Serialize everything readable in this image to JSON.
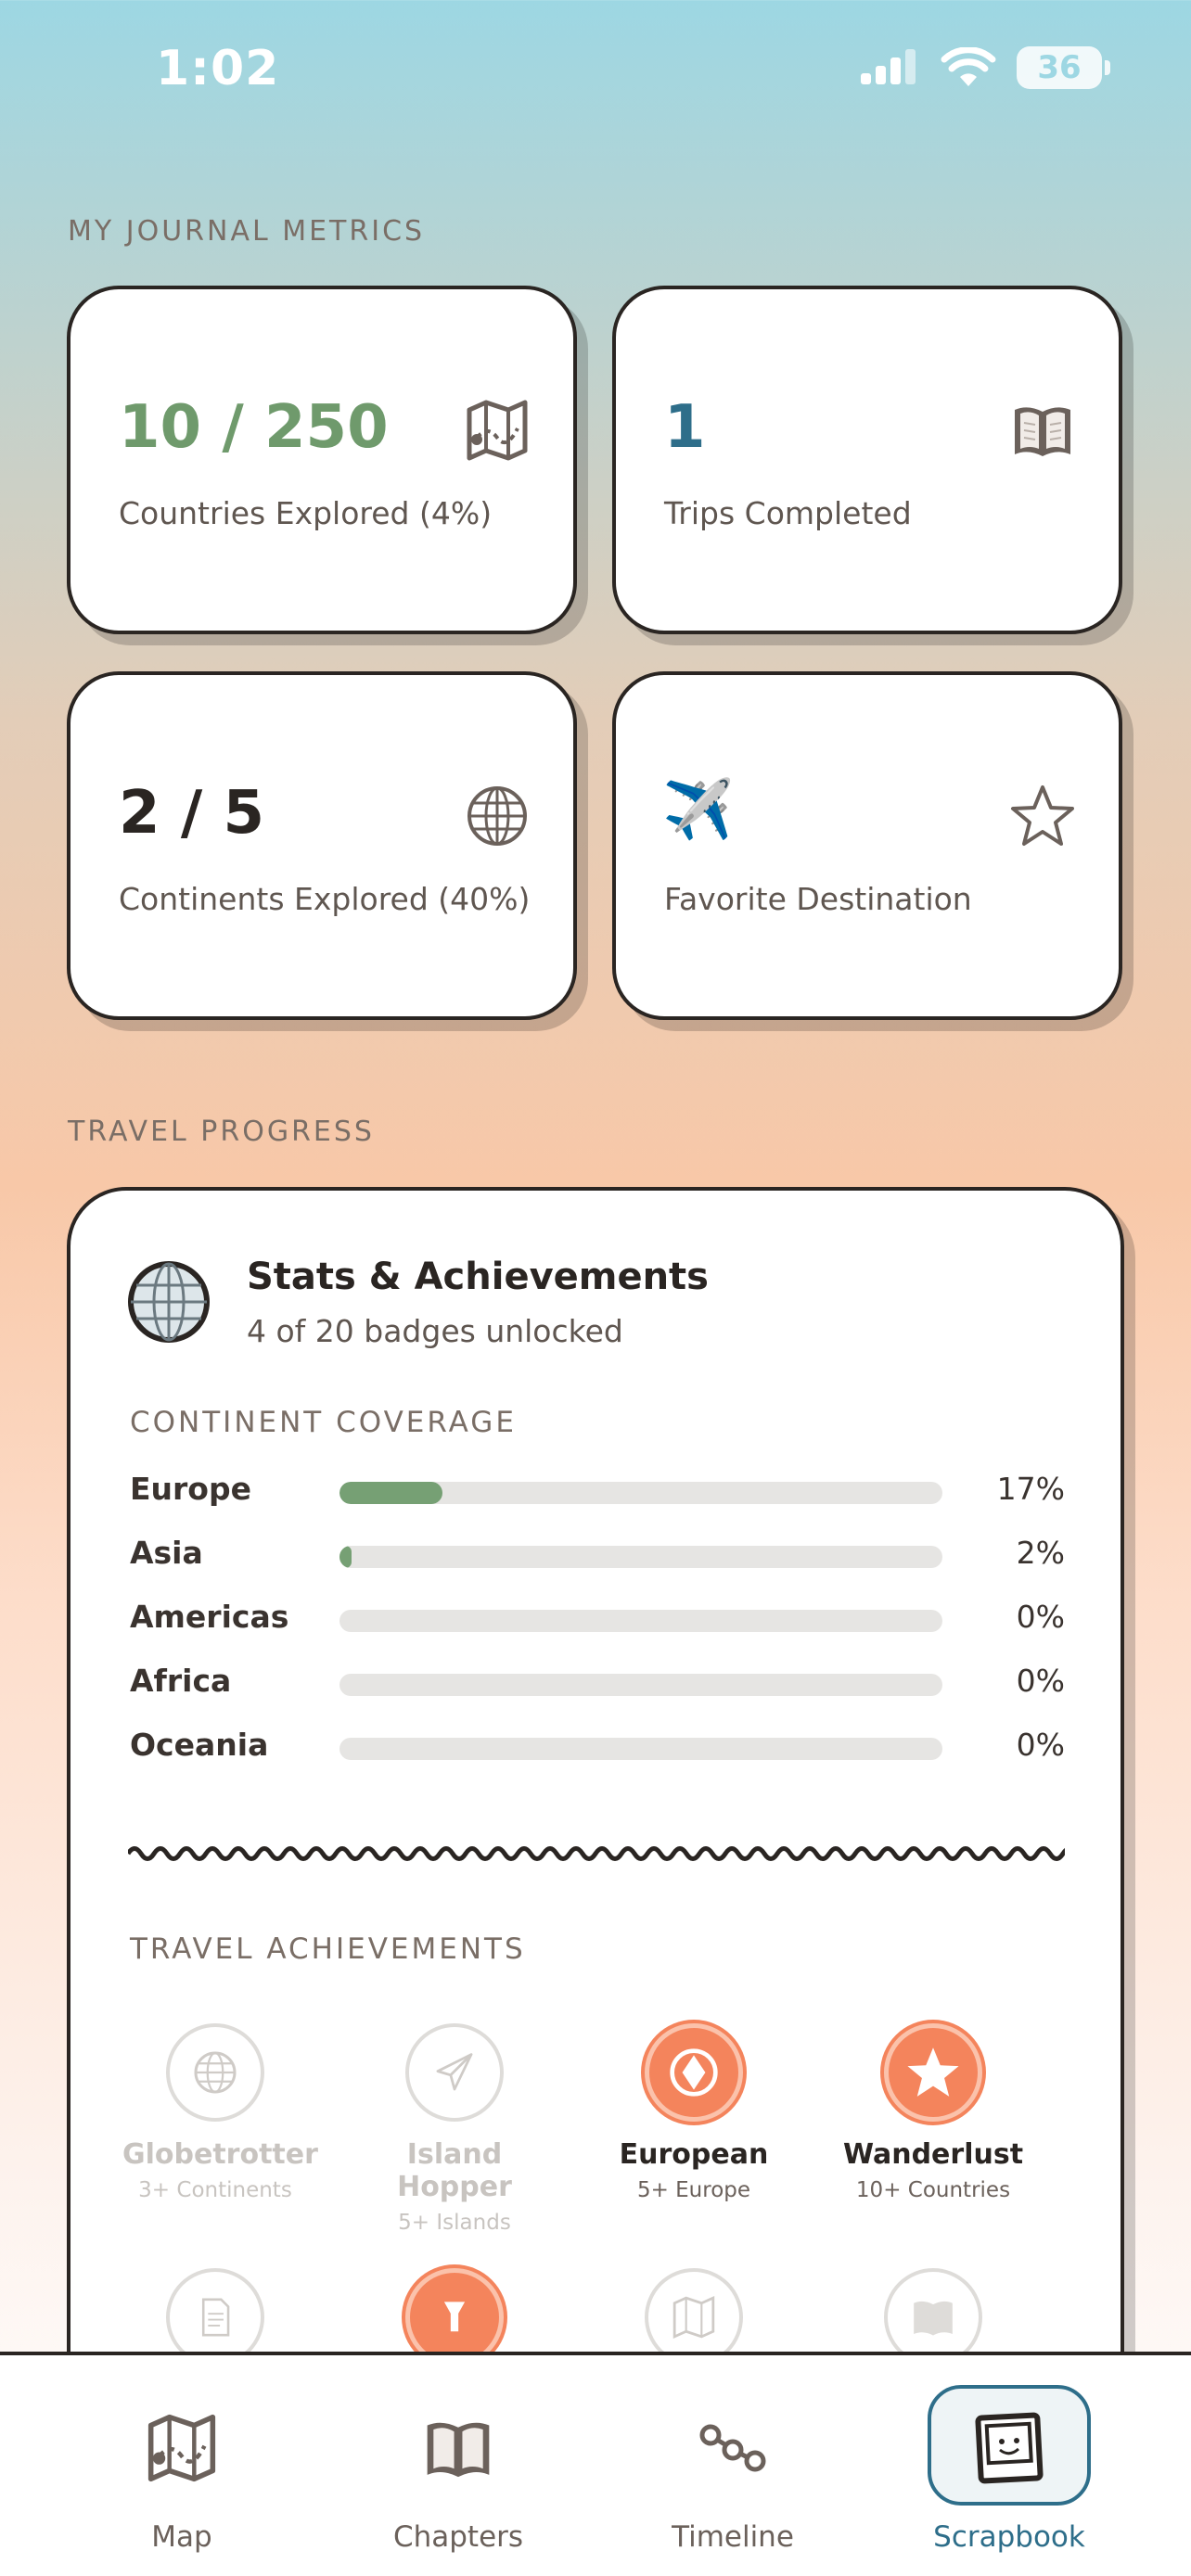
{
  "status_bar": {
    "time": "1:02",
    "battery": "36"
  },
  "metrics_section": {
    "label": "MY JOURNAL METRICS",
    "cards": [
      {
        "value": "10 / 250",
        "label": "Countries Explored (4%)",
        "icon": "map-icon",
        "color": "#6f9a6c"
      },
      {
        "value": "1",
        "label": "Trips Completed",
        "icon": "book-icon",
        "color": "#2e6e8a"
      },
      {
        "value": "2 / 5",
        "label": "Continents Explored (40%)",
        "icon": "globe-icon",
        "color": "#2a2522"
      },
      {
        "value": "✈️",
        "label": "Favorite Destination",
        "icon": "star-icon",
        "color": "#2a2522"
      }
    ]
  },
  "progress_section": {
    "label": "TRAVEL PROGRESS",
    "card": {
      "title": "Stats & Achievements",
      "subtitle": "4 of 20 badges unlocked",
      "coverage_label": "CONTINENT COVERAGE",
      "continents": [
        {
          "name": "Europe",
          "pct_label": "17%",
          "fraction": 0.17
        },
        {
          "name": "Asia",
          "pct_label": "2%",
          "fraction": 0.02
        },
        {
          "name": "Americas",
          "pct_label": "0%",
          "fraction": 0
        },
        {
          "name": "Africa",
          "pct_label": "0%",
          "fraction": 0
        },
        {
          "name": "Oceania",
          "pct_label": "0%",
          "fraction": 0
        }
      ],
      "achievements_label": "TRAVEL ACHIEVEMENTS",
      "badges": [
        {
          "name": "Globetrotter",
          "requirement": "3+ Continents",
          "unlocked": false,
          "icon": "globe-icon"
        },
        {
          "name": "Island Hopper",
          "requirement": "5+ Islands",
          "unlocked": false,
          "icon": "paper-plane-icon"
        },
        {
          "name": "European",
          "requirement": "5+ Europe",
          "unlocked": true,
          "icon": "diamond-icon"
        },
        {
          "name": "Wanderlust",
          "requirement": "10+ Countries",
          "unlocked": true,
          "icon": "star-icon"
        }
      ]
    }
  },
  "tab_bar": {
    "tabs": [
      {
        "label": "Map",
        "icon": "map-icon",
        "active": false
      },
      {
        "label": "Chapters",
        "icon": "book-icon",
        "active": false
      },
      {
        "label": "Timeline",
        "icon": "timeline-icon",
        "active": false
      },
      {
        "label": "Scrapbook",
        "icon": "polaroid-icon",
        "active": true
      }
    ]
  }
}
